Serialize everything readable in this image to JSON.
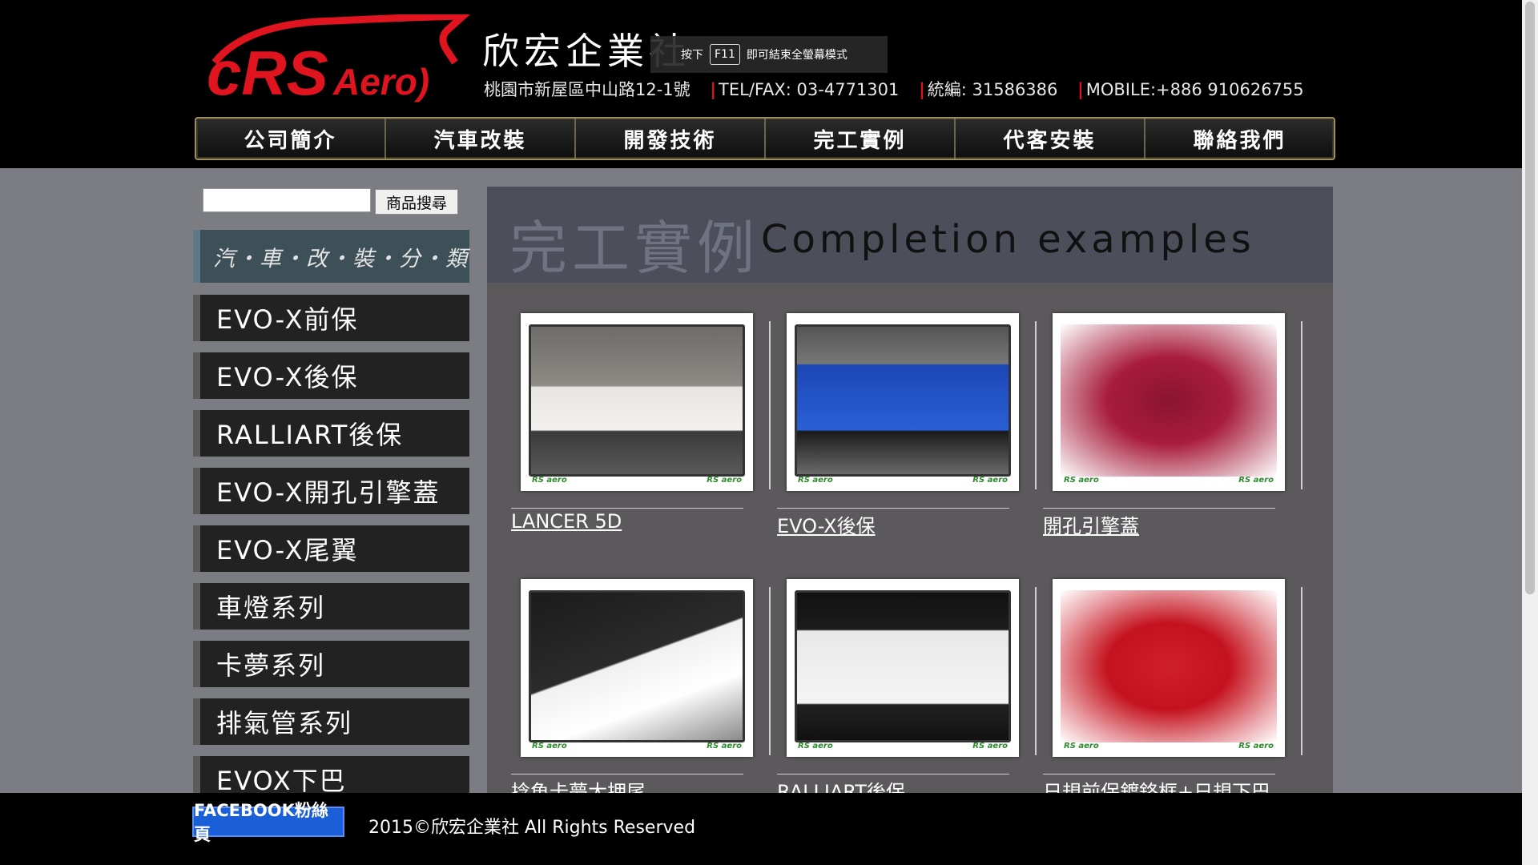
{
  "header": {
    "logo_text": "RS Aero",
    "company_name": "欣宏企業社",
    "address": "桃園市新屋區中山路12-1號",
    "tel_fax": "TEL/FAX: 03-4771301",
    "tax_id": "統編: 31586386",
    "mobile": "MOBILE:+886 910626755"
  },
  "toast": {
    "pre": "按下",
    "key": "F11",
    "post": "即可結束全螢幕模式"
  },
  "nav": [
    "公司簡介",
    "汽車改裝",
    "開發技術",
    "完工實例",
    "代客安裝",
    "聯絡我們"
  ],
  "search": {
    "placeholder": "",
    "button_label": "商品搜尋"
  },
  "sidebar": {
    "header": "汽・車・改・裝・分・類",
    "items": [
      "EVO-X前保",
      "EVO-X後保",
      "RALLIART後保",
      "EVO-X開孔引擎蓋",
      "EVO-X尾翼",
      "車燈系列",
      "卡夢系列",
      "排氣管系列",
      "EVOX下巴"
    ]
  },
  "main": {
    "title_cn": "完工實例",
    "title_en": "Completion examples",
    "watermark": "RS aero",
    "products": [
      {
        "caption": "LANCER 5D"
      },
      {
        "caption": "EVO-X後保"
      },
      {
        "caption": "開孔引擎蓋"
      },
      {
        "caption": "捻魚卡夢大押尾"
      },
      {
        "caption": "RALLIART後保"
      },
      {
        "caption": "日規前保鍍鉻框+日規下巴"
      }
    ]
  },
  "footer": {
    "facebook_label": "FACEBOOK粉絲頁",
    "copyright": "2015©欣宏企業社 All Rights Reserved"
  },
  "colors": {
    "brand_red": "#e0141e",
    "facebook_blue": "#1a5fd8"
  }
}
